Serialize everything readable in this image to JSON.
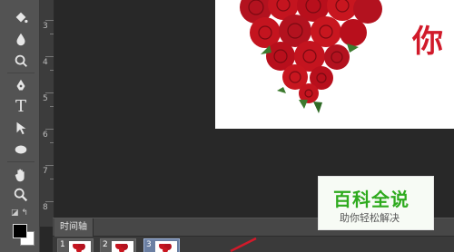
{
  "toolbar": {
    "tools": [
      {
        "icon": "paint-bucket-icon"
      },
      {
        "icon": "blur-icon"
      },
      {
        "icon": "dodge-icon"
      },
      {
        "icon": "pen-icon"
      },
      {
        "icon": "type-icon",
        "glyph": "T"
      },
      {
        "icon": "path-select-icon"
      },
      {
        "icon": "ellipse-icon"
      },
      {
        "icon": "hand-icon"
      },
      {
        "icon": "zoom-icon"
      }
    ],
    "colors": {
      "foreground": "#000000",
      "background": "#ffffff"
    }
  },
  "ruler": {
    "labels": [
      "3",
      "4",
      "5",
      "6",
      "7",
      "8"
    ]
  },
  "document": {
    "text": "你"
  },
  "timeline": {
    "tab_label": "时间轴",
    "frames": [
      {
        "number": "1"
      },
      {
        "number": "2"
      },
      {
        "number": "3",
        "selected": true
      }
    ]
  },
  "watermark": {
    "title": "百科全说",
    "subtitle": "助你轻松解决"
  },
  "colors": {
    "panel": "#535353",
    "canvas_bg": "#282828",
    "accent_red": "#d11a2a",
    "watermark_green": "#2eaa1e"
  }
}
